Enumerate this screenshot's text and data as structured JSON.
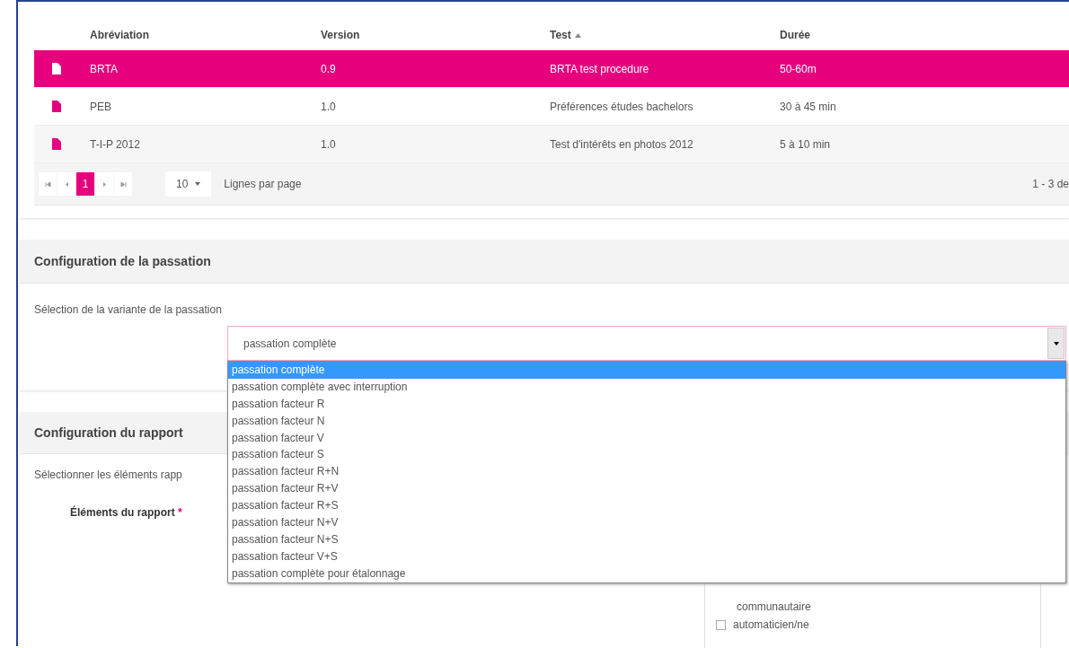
{
  "grid": {
    "columns": [
      {
        "label": "Abréviation"
      },
      {
        "label": "Version"
      },
      {
        "label": "Test",
        "sorted": true
      },
      {
        "label": "Durée"
      }
    ],
    "rows": [
      {
        "selected": true,
        "cells": [
          "BRTA",
          "0.9",
          "BRTA test procedure",
          "50-60m"
        ]
      },
      {
        "selected": false,
        "cells": [
          "PEB",
          "1.0",
          "Préférences études bachelors",
          "30 à 45 min"
        ]
      },
      {
        "selected": false,
        "cells": [
          "T-I-P 2012",
          "1.0",
          "Test d'intérêts en photos 2012",
          "5 à 10 min"
        ]
      }
    ],
    "pager": {
      "pages": [
        {
          "label": "1",
          "selected": true
        }
      ],
      "page_size": "10",
      "page_size_label": "Lignes par page",
      "range": "1 - 3 de"
    }
  },
  "passation": {
    "title": "Configuration de la passation",
    "label": "Sélection de la variante de la passation",
    "value": "passation complète",
    "expanded": true,
    "options": [
      {
        "label": "passation complète",
        "selected": true
      },
      {
        "label": "passation complète avec interruption",
        "selected": false
      },
      {
        "label": "passation facteur R",
        "selected": false
      },
      {
        "label": "passation facteur N",
        "selected": false
      },
      {
        "label": "passation facteur V",
        "selected": false
      },
      {
        "label": "passation facteur S",
        "selected": false
      },
      {
        "label": "passation facteur R+N",
        "selected": false
      },
      {
        "label": "passation facteur R+V",
        "selected": false
      },
      {
        "label": "passation facteur R+S",
        "selected": false
      },
      {
        "label": "passation facteur N+V",
        "selected": false
      },
      {
        "label": "passation facteur N+S",
        "selected": false
      },
      {
        "label": "passation facteur V+S",
        "selected": false
      },
      {
        "label": "passation complète pour étalonnage",
        "selected": false
      }
    ]
  },
  "rapport": {
    "title": "Configuration du rapport",
    "intro": "Sélectionner les éléments rapp",
    "field_label": "Éléments du rapport",
    "required_mark": "*",
    "items": [
      {
        "kind": "text",
        "label": "communautaire"
      },
      {
        "kind": "checkbox",
        "label": "automaticien/ne",
        "checked": false
      }
    ]
  }
}
